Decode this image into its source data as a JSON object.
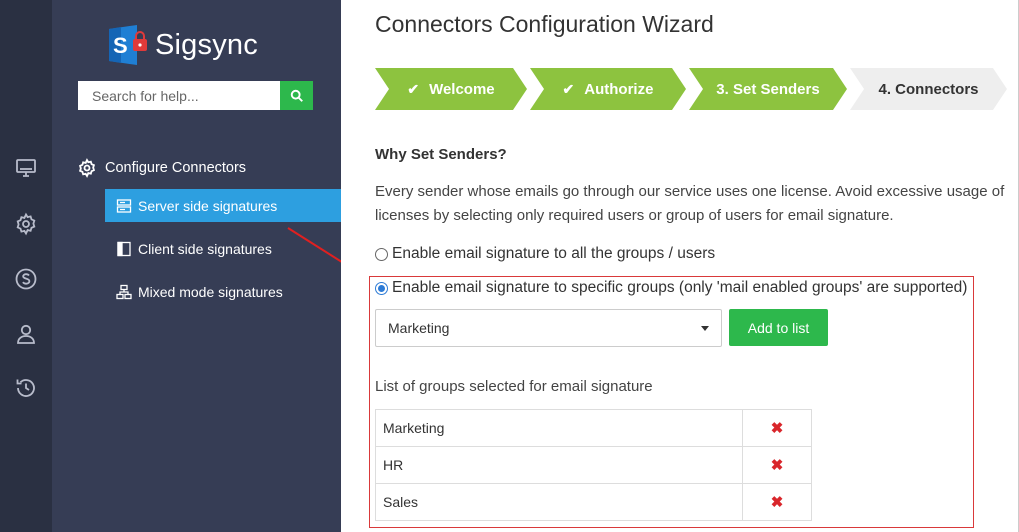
{
  "app": {
    "name": "Sigsync"
  },
  "search": {
    "placeholder": "Search for help..."
  },
  "rail": {
    "icons": [
      "monitor-icon",
      "gear-icon",
      "sigsync-s-icon",
      "user-icon",
      "history-icon"
    ]
  },
  "sidebar": {
    "section_label": "Configure Connectors",
    "items": [
      {
        "label": "Server side signatures",
        "active": true
      },
      {
        "label": "Client side signatures",
        "active": false
      },
      {
        "label": "Mixed mode signatures",
        "active": false
      }
    ]
  },
  "main": {
    "title": "Connectors Configuration Wizard",
    "steps": [
      {
        "label": "Welcome",
        "state": "done"
      },
      {
        "label": "Authorize",
        "state": "done"
      },
      {
        "label": "3. Set Senders",
        "state": "current"
      },
      {
        "label": "4. Connectors",
        "state": "todo"
      }
    ],
    "section_title": "Why Set Senders?",
    "description": "Every sender whose emails go through our service uses one license. Avoid excessive usage of licenses by selecting only required users or group of users for email signature.",
    "options": [
      {
        "label": "Enable email signature to all the groups / users",
        "selected": false
      },
      {
        "label": "Enable email signature to specific groups (only 'mail enabled groups' are supported)",
        "selected": true
      }
    ],
    "group_select_value": "Marketing",
    "add_button": "Add to list",
    "list_title": "List of groups selected for email signature",
    "groups": [
      {
        "name": "Marketing",
        "remove": "✖"
      },
      {
        "name": "HR",
        "remove": "✖"
      },
      {
        "name": "Sales",
        "remove": "✖"
      }
    ]
  },
  "colors": {
    "accent_green": "#2db84c",
    "step_green": "#8dc33f",
    "active_blue": "#2d9fe0",
    "sidebar_bg": "#363d55",
    "highlight_red": "#d9393a"
  }
}
